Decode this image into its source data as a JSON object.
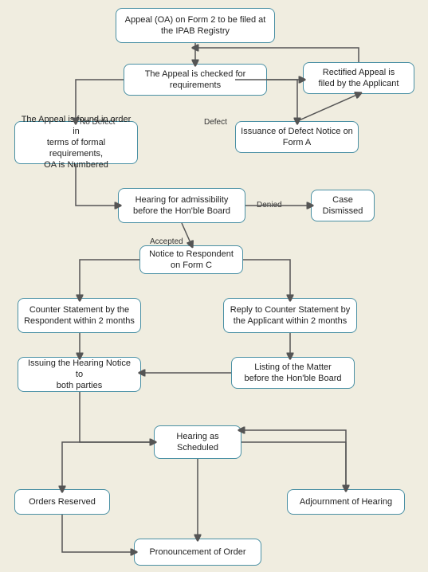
{
  "boxes": {
    "appeal_form": {
      "label": "Appeal (OA) on Form 2 to be filed at\nthe IPAB Registry"
    },
    "appeal_checked": {
      "label": "The Appeal is checked for\nrequirements"
    },
    "rectified_appeal": {
      "label": "Rectified Appeal is\nfiled by the Applicant"
    },
    "appeal_found": {
      "label": "The Appeal is found in order in\nterms of formal requirements,\nOA is Numbered"
    },
    "defect_notice": {
      "label": "Issuance of Defect Notice on\nForm A"
    },
    "hearing_admissibility": {
      "label": "Hearing for admissibility\nbefore the Hon'ble Board"
    },
    "case_dismissed": {
      "label": "Case\nDismissed"
    },
    "notice_respondent": {
      "label": "Notice to Respondent\non Form C"
    },
    "counter_statement": {
      "label": "Counter Statement by the\nRespondent within 2 months"
    },
    "reply_counter": {
      "label": "Reply to Counter Statement by\nthe Applicant within 2 months"
    },
    "listing_matter": {
      "label": "Listing of the Matter\nbefore the Hon'ble Board"
    },
    "issuing_hearing": {
      "label": "Issuing the Hearing Notice to\nboth parties"
    },
    "hearing_scheduled": {
      "label": "Hearing as\nScheduled"
    },
    "orders_reserved": {
      "label": "Orders Reserved"
    },
    "adjournment": {
      "label": "Adjournment of Hearing"
    },
    "pronouncement": {
      "label": "Pronouncement of Order"
    }
  },
  "labels": {
    "no_defect": "No Defect",
    "defect": "Defect",
    "accepted": "Accepted",
    "denied": "Denied"
  }
}
